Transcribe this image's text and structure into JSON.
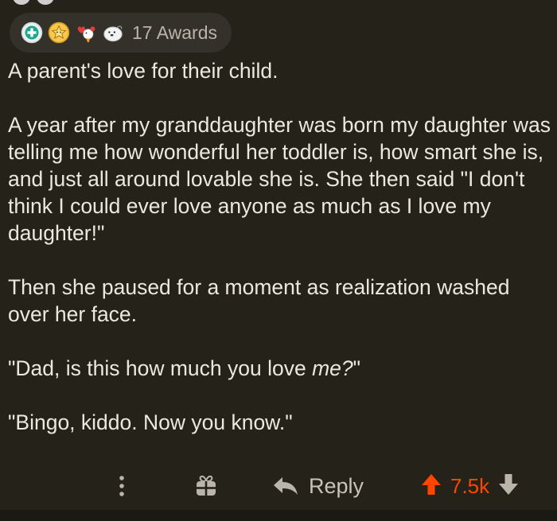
{
  "awards": {
    "icons": [
      "helpful-award-icon",
      "wholesome-award-icon",
      "heartwarming-award-icon",
      "seal-award-icon"
    ],
    "count_label": "17 Awards"
  },
  "comment": {
    "paragraphs": [
      "A parent's love for their child.",
      "A year after my granddaughter was born my daughter was telling me how wonderful her toddler is, how smart she is, and just all around lovable she is. She then said \"I don't think I could ever love anyone as much as I love my daughter!\"",
      "Then she paused for a moment as realization washed over her face.",
      "\"Dad, is this how much you love ",
      "\"Bingo, kiddo. Now you know.\""
    ],
    "emphasis": "me?",
    "emphasis_tail": "\""
  },
  "actions": {
    "reply_label": "Reply",
    "score": "7.5k"
  },
  "colors": {
    "background": "#252219",
    "text": "#ebe8e0",
    "upvote": "#ff4500",
    "muted": "#b9b5ab"
  }
}
